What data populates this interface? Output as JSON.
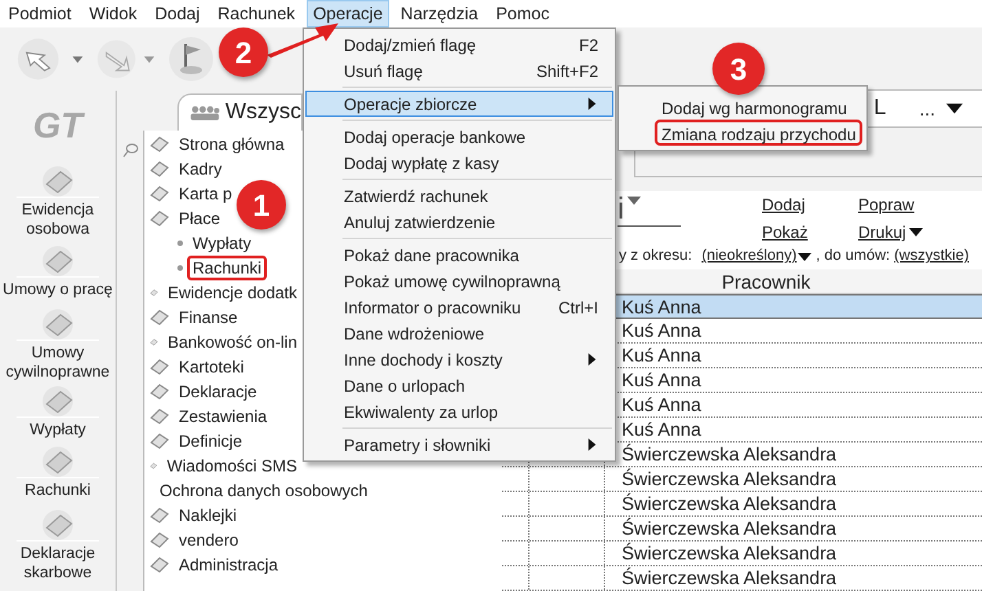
{
  "menubar": [
    {
      "label": "Podmiot",
      "selected": false
    },
    {
      "label": "Widok",
      "selected": false
    },
    {
      "label": "Dodaj",
      "selected": false
    },
    {
      "label": "Rachunek",
      "selected": false
    },
    {
      "label": "Operacje",
      "selected": true
    },
    {
      "label": "Narzędzia",
      "selected": false
    },
    {
      "label": "Pomoc",
      "selected": false
    }
  ],
  "logo": "GT",
  "sidebar": {
    "items": [
      {
        "label": "Ewidencja osobowa"
      },
      {
        "label": "Umowy o pracę"
      },
      {
        "label": "Umowy cywilnoprawne"
      },
      {
        "label": "Wypłaty"
      },
      {
        "label": "Rachunki"
      },
      {
        "label": "Deklaracje skarbowe"
      }
    ]
  },
  "nav_tab": {
    "label": "Wszysc"
  },
  "nav_tree": [
    {
      "label": "Strona główna",
      "highlighted": false
    },
    {
      "label": "Kadry",
      "highlighted": false
    },
    {
      "label": "Karta p",
      "highlighted": false
    },
    {
      "label": "Płace",
      "highlighted": false,
      "children": [
        {
          "label": "Wypłaty",
          "highlighted": false
        },
        {
          "label": "Rachunki",
          "highlighted": true
        }
      ]
    },
    {
      "label": "Ewidencje dodatk",
      "highlighted": false
    },
    {
      "label": "Finanse",
      "highlighted": false
    },
    {
      "label": "Bankowość on-lin",
      "highlighted": false
    },
    {
      "label": "Kartoteki",
      "highlighted": false
    },
    {
      "label": "Deklaracje",
      "highlighted": false
    },
    {
      "label": "Zestawienia",
      "highlighted": false
    },
    {
      "label": "Definicje",
      "highlighted": false
    },
    {
      "label": "Wiadomości SMS",
      "highlighted": false
    },
    {
      "label": "Ochrona danych osobowych",
      "highlighted": false
    },
    {
      "label": "Naklejki",
      "highlighted": false
    },
    {
      "label": "vendero",
      "highlighted": false
    },
    {
      "label": "Administracja",
      "highlighted": false
    }
  ],
  "tab_strip": {
    "label": "L",
    "more": "..."
  },
  "view_title": "i",
  "actions": [
    {
      "label": "Dodaj",
      "dropdown": false
    },
    {
      "label": "Popraw",
      "dropdown": false
    },
    {
      "label": "Pokaż",
      "dropdown": false
    },
    {
      "label": "Drukuj",
      "dropdown": true
    }
  ],
  "filter": {
    "period_label": "y z okresu:",
    "period": "(nieokreślony)",
    "contracts_label": ", do umów:",
    "contracts": "(wszystkie)"
  },
  "table": {
    "columns": [
      "Pracownik"
    ],
    "rows": [
      {
        "cells": [
          "Kuś Anna"
        ],
        "selected": true
      },
      {
        "cells": [
          "Kuś Anna"
        ],
        "selected": false
      },
      {
        "cells": [
          "Kuś Anna"
        ],
        "selected": false
      },
      {
        "cells": [
          "Kuś Anna"
        ],
        "selected": false
      },
      {
        "cells": [
          "Kuś Anna"
        ],
        "selected": false
      },
      {
        "cells": [
          "Kuś Anna"
        ],
        "selected": false
      },
      {
        "cells": [
          "Świerczewska Aleksandra"
        ],
        "selected": false
      },
      {
        "cells": [
          "Świerczewska Aleksandra"
        ],
        "selected": false
      },
      {
        "cells": [
          "Świerczewska Aleksandra"
        ],
        "selected": false
      },
      {
        "cells": [
          "Świerczewska Aleksandra"
        ],
        "selected": false
      },
      {
        "cells": [
          "Świerczewska Aleksandra"
        ],
        "selected": false
      },
      {
        "cells": [
          "Świerczewska Aleksandra"
        ],
        "selected": false
      }
    ]
  },
  "operations_menu": [
    {
      "label": "Dodaj/zmień flagę",
      "shortcut": "F2",
      "submenu": false,
      "selected": false,
      "separator_before": false
    },
    {
      "label": "Usuń flagę",
      "shortcut": "Shift+F2",
      "submenu": false,
      "selected": false,
      "separator_before": false
    },
    {
      "label": "Operacje zbiorcze",
      "submenu": true,
      "selected": true,
      "separator_before": true
    },
    {
      "label": "Dodaj operacje bankowe",
      "submenu": false,
      "selected": false,
      "separator_before": true
    },
    {
      "label": "Dodaj wypłatę z kasy",
      "submenu": false,
      "selected": false,
      "separator_before": false
    },
    {
      "label": "Zatwierdź rachunek",
      "submenu": false,
      "selected": false,
      "separator_before": true
    },
    {
      "label": "Anuluj zatwierdzenie",
      "submenu": false,
      "selected": false,
      "separator_before": false
    },
    {
      "label": "Pokaż dane pracownika",
      "submenu": false,
      "selected": false,
      "separator_before": true
    },
    {
      "label": "Pokaż umowę cywilnoprawną",
      "submenu": false,
      "selected": false,
      "separator_before": false
    },
    {
      "label": "Informator o pracowniku",
      "shortcut": "Ctrl+I",
      "submenu": false,
      "selected": false,
      "separator_before": false
    },
    {
      "label": "Dane wdrożeniowe",
      "submenu": false,
      "selected": false,
      "separator_before": false
    },
    {
      "label": "Inne dochody i koszty",
      "submenu": true,
      "selected": false,
      "separator_before": false
    },
    {
      "label": "Dane o urlopach",
      "submenu": false,
      "selected": false,
      "separator_before": false
    },
    {
      "label": "Ekwiwalenty za urlop",
      "submenu": false,
      "selected": false,
      "separator_before": false
    },
    {
      "label": "Parametry i słowniki",
      "submenu": true,
      "selected": false,
      "separator_before": true
    }
  ],
  "submenu": [
    {
      "label": "Dodaj wg harmonogramu",
      "highlighted": false
    },
    {
      "label": "Zmiana rodzaju przychodu",
      "highlighted": true
    }
  ],
  "callouts": [
    {
      "number": "1"
    },
    {
      "number": "2"
    },
    {
      "number": "3"
    }
  ]
}
